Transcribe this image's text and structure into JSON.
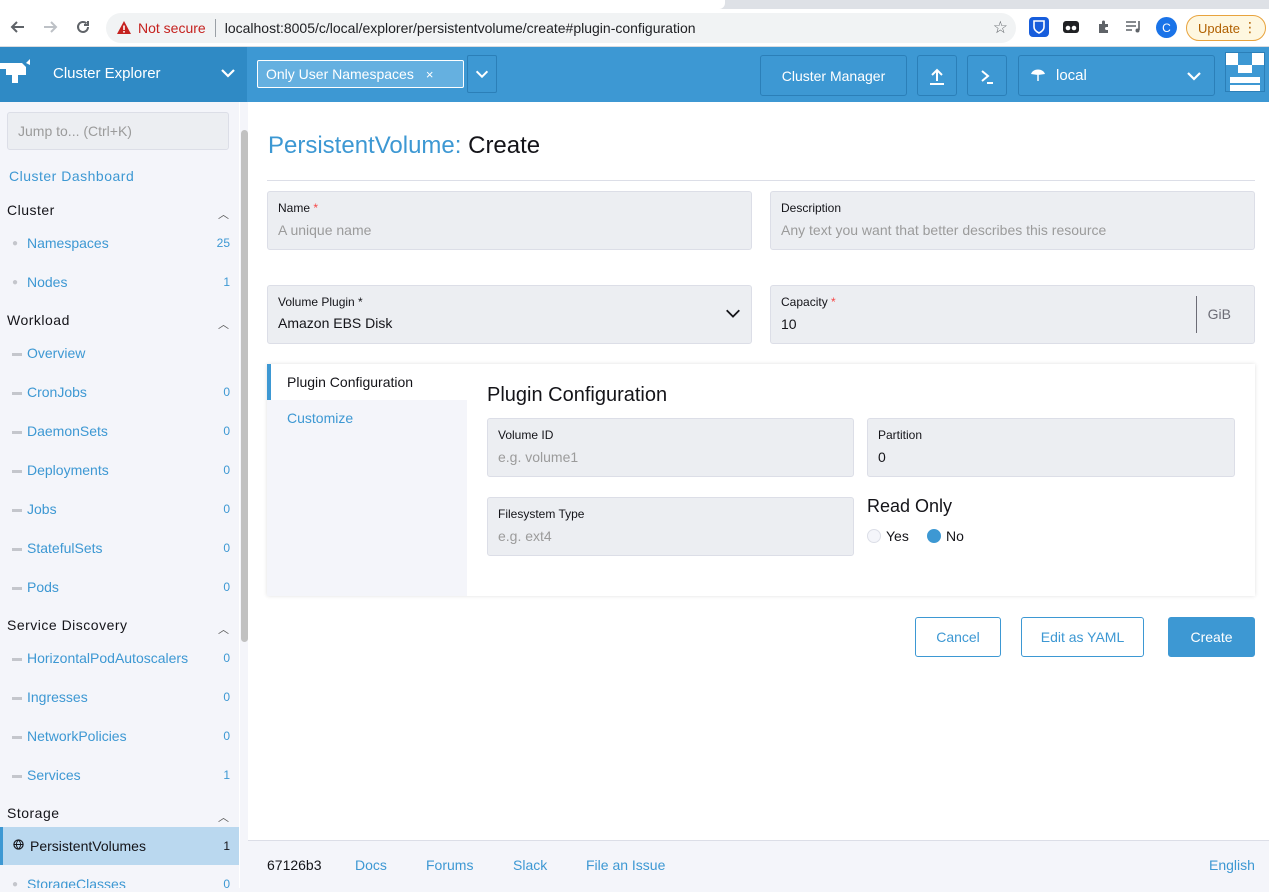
{
  "browser": {
    "not_secure": "Not secure",
    "url": "localhost:8005/c/local/explorer/persistentvolume/create#plugin-configuration",
    "profile_initial": "C",
    "update_label": "Update"
  },
  "header": {
    "app_title": "Cluster Explorer",
    "namespace_filter": "Only User Namespaces",
    "namespace_remove": "×",
    "cluster_manager": "Cluster Manager",
    "cluster_name": "local"
  },
  "sidebar": {
    "jump_placeholder": "Jump to... (Ctrl+K)",
    "dashboard": "Cluster Dashboard",
    "groups": {
      "cluster": "Cluster",
      "workload": "Workload",
      "service_discovery": "Service Discovery",
      "storage": "Storage"
    },
    "items": {
      "namespaces": {
        "label": "Namespaces",
        "count": "25"
      },
      "nodes": {
        "label": "Nodes",
        "count": "1"
      },
      "overview": {
        "label": "Overview"
      },
      "cronjobs": {
        "label": "CronJobs",
        "count": "0"
      },
      "daemonsets": {
        "label": "DaemonSets",
        "count": "0"
      },
      "deployments": {
        "label": "Deployments",
        "count": "0"
      },
      "jobs": {
        "label": "Jobs",
        "count": "0"
      },
      "statefulsets": {
        "label": "StatefulSets",
        "count": "0"
      },
      "pods": {
        "label": "Pods",
        "count": "0"
      },
      "hpa": {
        "label": "HorizontalPodAutoscalers",
        "count": "0"
      },
      "ingresses": {
        "label": "Ingresses",
        "count": "0"
      },
      "networkpolicies": {
        "label": "NetworkPolicies",
        "count": "0"
      },
      "services": {
        "label": "Services",
        "count": "1"
      },
      "persistentvolumes": {
        "label": "PersistentVolumes",
        "count": "1"
      },
      "storageclasses": {
        "label": "StorageClasses",
        "count": "0"
      }
    }
  },
  "page": {
    "title_type": "PersistentVolume:",
    "title_action": "Create",
    "name": {
      "label": "Name",
      "required": "*",
      "placeholder": "A unique name"
    },
    "description": {
      "label": "Description",
      "placeholder": "Any text you want that better describes this resource"
    },
    "volume_plugin": {
      "label": "Volume Plugin *",
      "value": "Amazon EBS Disk"
    },
    "capacity": {
      "label": "Capacity",
      "required": "*",
      "value": "10",
      "unit": "GiB"
    },
    "tabs": {
      "plugin_configuration": "Plugin Configuration",
      "customize": "Customize"
    },
    "plugin_config": {
      "title": "Plugin Configuration",
      "volume_id": {
        "label": "Volume ID",
        "placeholder": "e.g. volume1"
      },
      "partition": {
        "label": "Partition",
        "value": "0"
      },
      "filesystem_type": {
        "label": "Filesystem Type",
        "placeholder": "e.g. ext4"
      },
      "read_only": {
        "label": "Read Only",
        "yes": "Yes",
        "no": "No",
        "selected": "No"
      }
    },
    "buttons": {
      "cancel": "Cancel",
      "edit_yaml": "Edit as YAML",
      "create": "Create"
    }
  },
  "footer": {
    "version": "67126b3",
    "docs": "Docs",
    "forums": "Forums",
    "slack": "Slack",
    "file_issue": "File an Issue",
    "language": "English"
  },
  "colors": {
    "accent": "#3d98d3",
    "header": "#3d98d3",
    "required": "#f64747"
  }
}
